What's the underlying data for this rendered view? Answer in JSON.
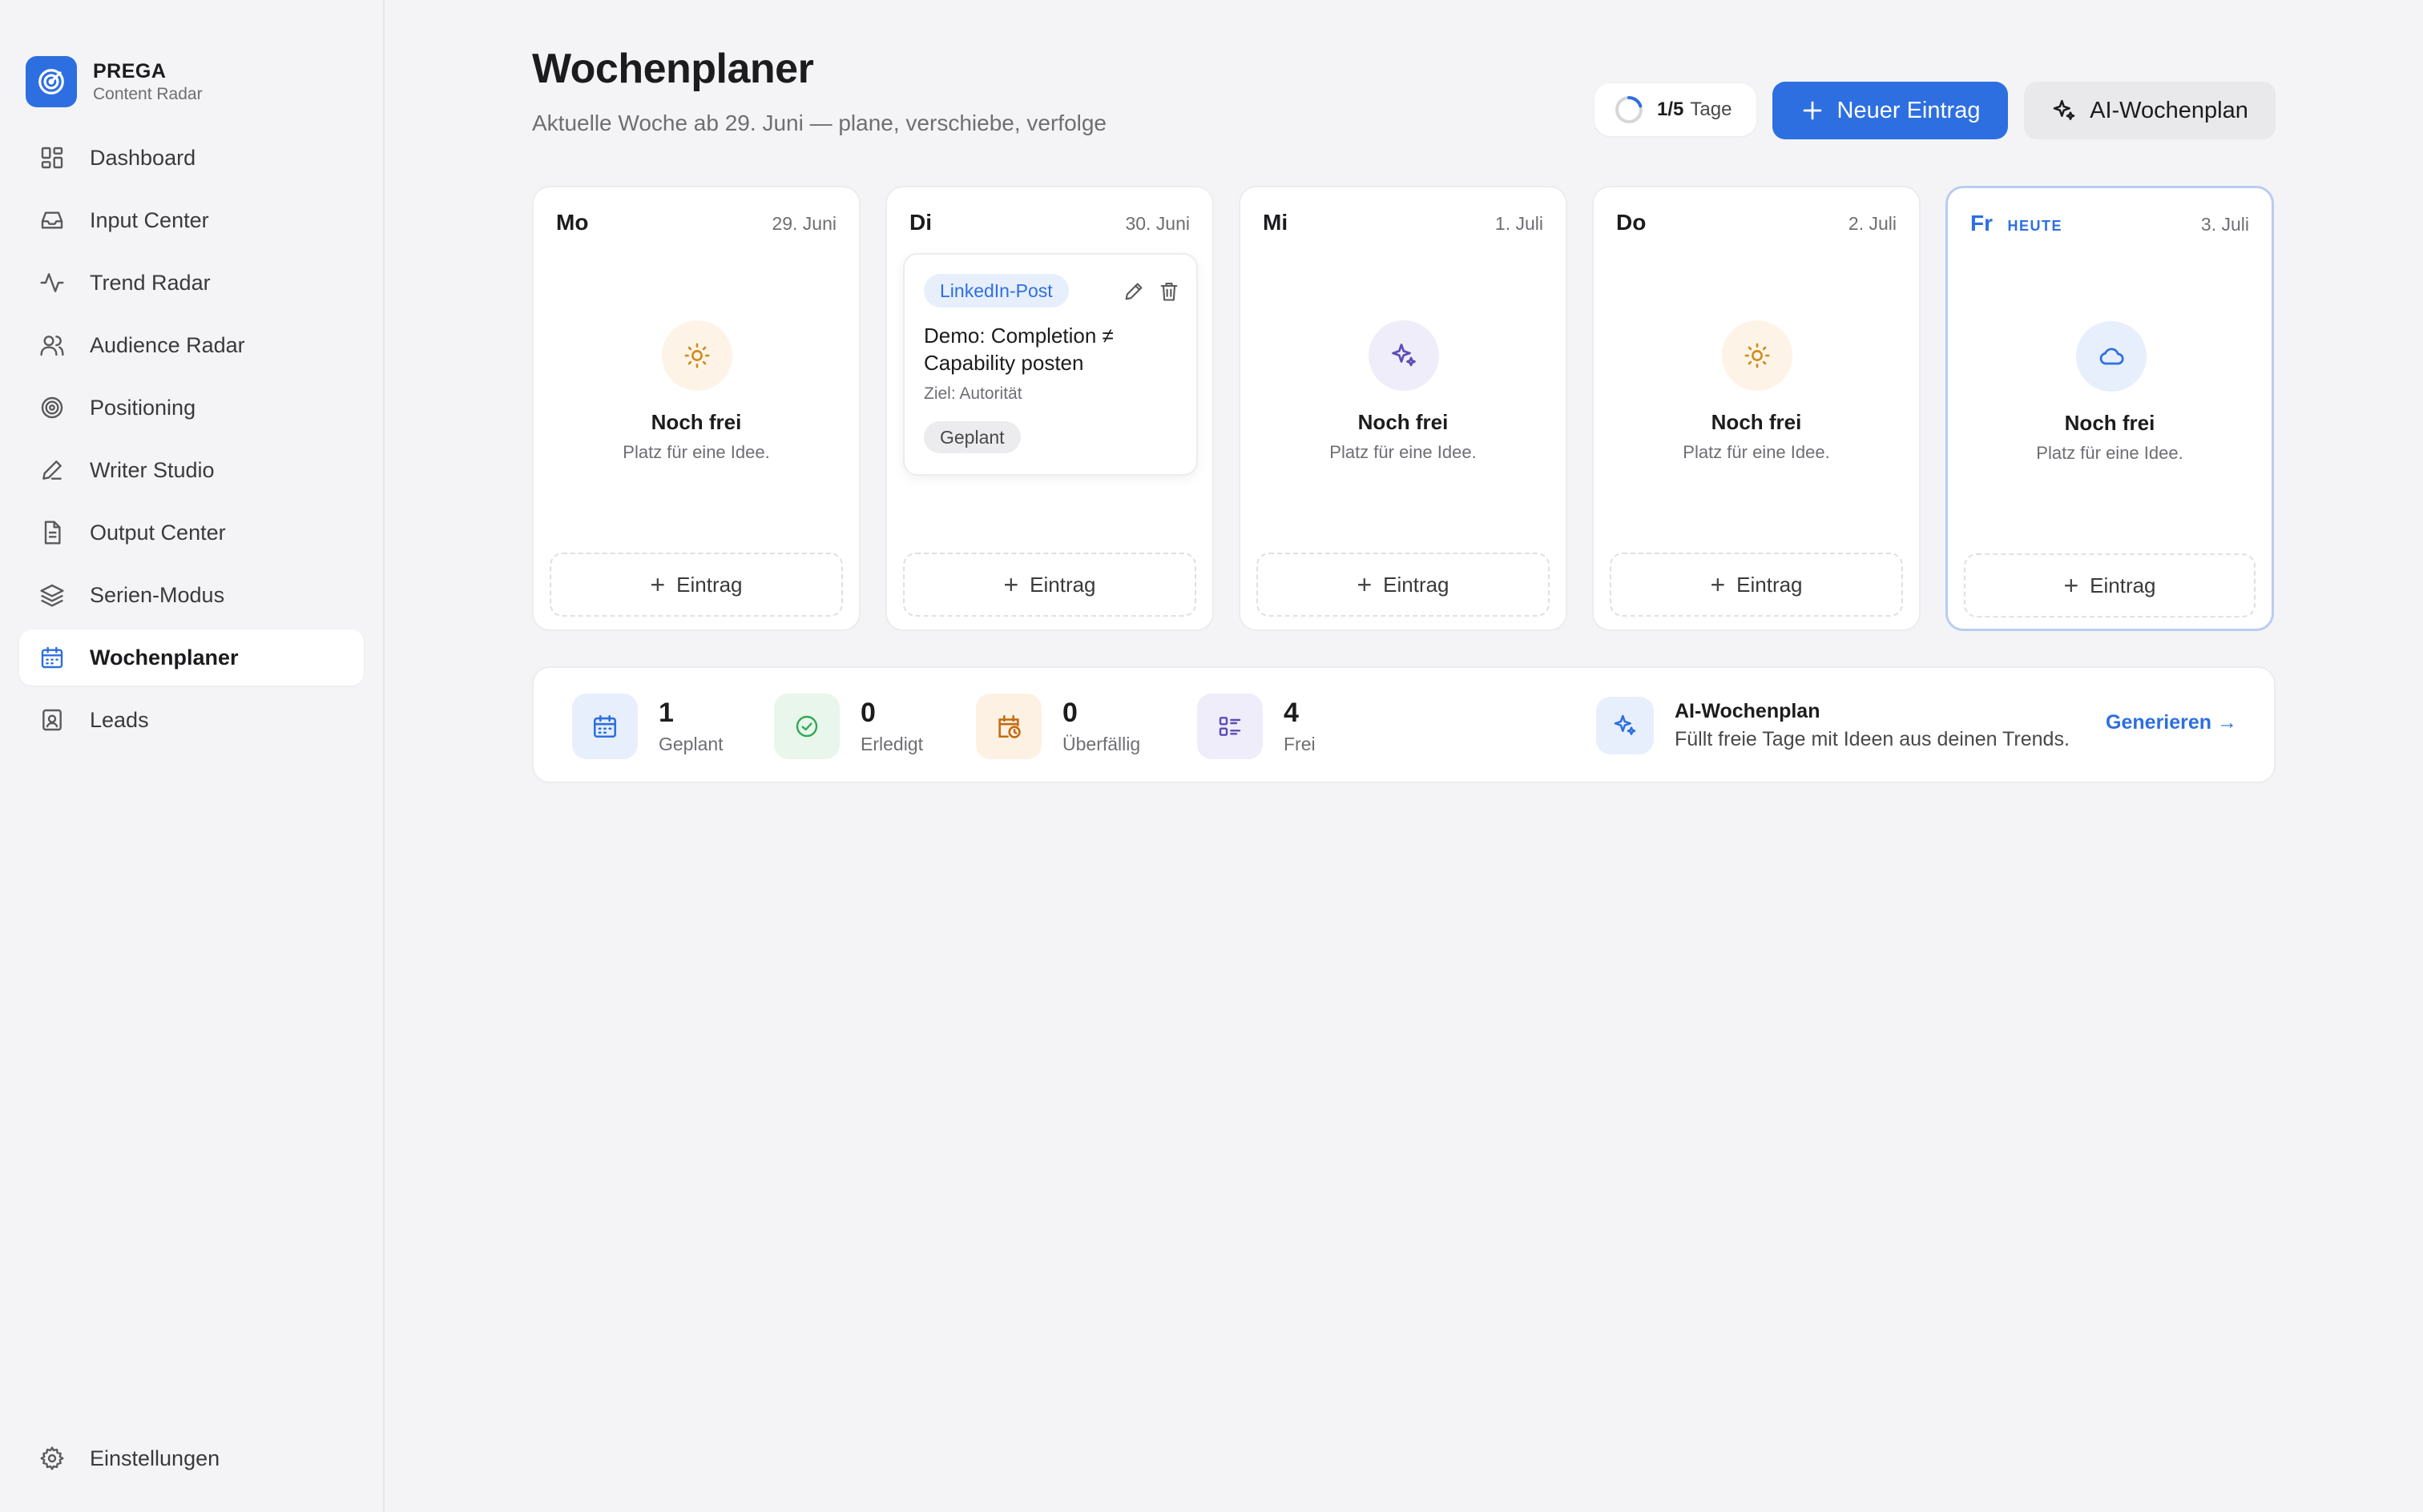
{
  "brand": {
    "name": "PREGA",
    "subtitle": "Content Radar",
    "icon": "radar-icon",
    "color": "#2d6fe0"
  },
  "sidebar": {
    "items": [
      {
        "label": "Dashboard",
        "icon": "dashboard-icon",
        "active": false
      },
      {
        "label": "Input Center",
        "icon": "inbox-icon",
        "active": false
      },
      {
        "label": "Trend Radar",
        "icon": "activity-icon",
        "active": false
      },
      {
        "label": "Audience Radar",
        "icon": "users-icon",
        "active": false
      },
      {
        "label": "Positioning",
        "icon": "target-icon",
        "active": false
      },
      {
        "label": "Writer Studio",
        "icon": "pen-icon",
        "active": false
      },
      {
        "label": "Output Center",
        "icon": "document-icon",
        "active": false
      },
      {
        "label": "Serien-Modus",
        "icon": "layers-icon",
        "active": false
      },
      {
        "label": "Wochenplaner",
        "icon": "calendar-icon",
        "active": true
      },
      {
        "label": "Leads",
        "icon": "contact-icon",
        "active": false
      }
    ],
    "settings": {
      "label": "Einstellungen",
      "icon": "gear-icon"
    }
  },
  "header": {
    "title": "Wochenplaner",
    "subtitle": "Aktuelle Woche ab 29. Juni — plane, verschiebe, verfolge",
    "progress": {
      "count": "1/5",
      "unit": "Tage",
      "fraction": 0.2
    },
    "new_entry_label": "Neuer Eintrag",
    "ai_plan_label": "AI-Wochenplan"
  },
  "days": [
    {
      "abbr": "Mo",
      "date": "29. Juni",
      "today": false,
      "empty_title": "Noch frei",
      "empty_sub": "Platz für eine Idee.",
      "icon": "sun-icon",
      "add_label": "Eintrag"
    },
    {
      "abbr": "Di",
      "date": "30. Juni",
      "today": false,
      "add_label": "Eintrag",
      "entry": {
        "tag": "LinkedIn-Post",
        "title": "Demo: Completion ≠ Capability posten",
        "goal": "Ziel: Autorität",
        "status": "Geplant"
      }
    },
    {
      "abbr": "Mi",
      "date": "1. Juli",
      "today": false,
      "empty_title": "Noch frei",
      "empty_sub": "Platz für eine Idee.",
      "icon": "sparkle-icon",
      "add_label": "Eintrag"
    },
    {
      "abbr": "Do",
      "date": "2. Juli",
      "today": false,
      "empty_title": "Noch frei",
      "empty_sub": "Platz für eine Idee.",
      "icon": "sun-icon",
      "add_label": "Eintrag"
    },
    {
      "abbr": "Fr",
      "date": "3. Juli",
      "today": true,
      "today_label": "HEUTE",
      "empty_title": "Noch frei",
      "empty_sub": "Platz für eine Idee.",
      "icon": "cloud-icon",
      "add_label": "Eintrag"
    }
  ],
  "stats": [
    {
      "value": "1",
      "label": "Geplant",
      "icon": "calendar-icon",
      "color": "#2d6fe0"
    },
    {
      "value": "0",
      "label": "Erledigt",
      "icon": "check-circle-icon",
      "color": "#34a853"
    },
    {
      "value": "0",
      "label": "Überfällig",
      "icon": "calendar-clock-icon",
      "color": "#c56a10"
    },
    {
      "value": "4",
      "label": "Frei",
      "icon": "list-icon",
      "color": "#5b4bb7"
    }
  ],
  "ai_promo": {
    "title": "AI-Wochenplan",
    "subtitle": "Füllt freie Tage mit Ideen aus deinen Trends.",
    "link": "Generieren →"
  }
}
